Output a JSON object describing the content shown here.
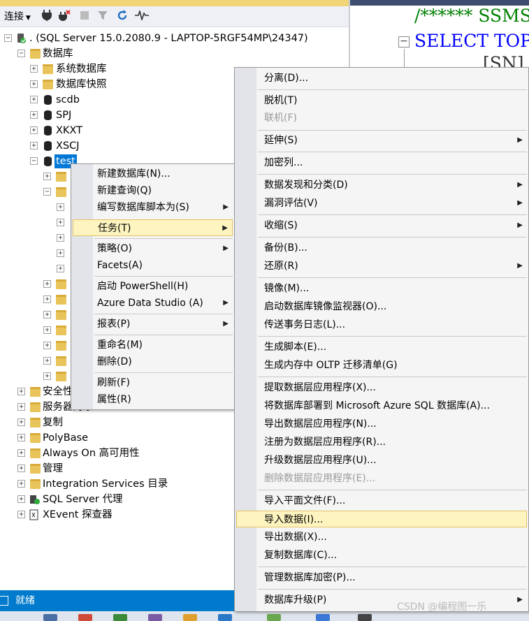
{
  "toolbar": {
    "connect_label": "连接"
  },
  "tree": {
    "server": ". (SQL Server 15.0.2080.9 - LAPTOP-5RGF54MP\\24347)",
    "databases": "数据库",
    "system_databases": "系统数据库",
    "db_snapshots": "数据库快照",
    "db_scdb": "scdb",
    "db_spj": "SPJ",
    "db_xkxt": "XKXT",
    "db_xscj": "XSCJ",
    "db_test": "test",
    "security": "安全性",
    "server_objects": "服务器对象",
    "replication": "复制",
    "polybase": "PolyBase",
    "always_on": "Always On 高可用性",
    "management": "管理",
    "integration_services": "Integration Services 目录",
    "sql_agent": "SQL Server 代理",
    "xevent": "XEvent 探查器"
  },
  "editor": {
    "line1": "/****** SSMS",
    "line2": "SELECT TOP (",
    "line3": "[SN]"
  },
  "status": {
    "text": "就绪"
  },
  "menu1": {
    "items": [
      {
        "label": "新建数据库(N)..."
      },
      {
        "label": "新建查询(Q)"
      },
      {
        "label": "编写数据库脚本为(S)"
      },
      {
        "label": "任务(T)"
      },
      {
        "label": "策略(O)"
      },
      {
        "label": "Facets(A)"
      },
      {
        "label": "启动 PowerShell(H)"
      },
      {
        "label": "Azure Data Studio (A)"
      },
      {
        "label": "报表(P)"
      },
      {
        "label": "重命名(M)"
      },
      {
        "label": "删除(D)"
      },
      {
        "label": "刷新(F)"
      },
      {
        "label": "属性(R)"
      }
    ]
  },
  "menu2": {
    "items": [
      {
        "label": "分离(D)..."
      },
      {
        "label": "脱机(T)"
      },
      {
        "label": "联机(F)"
      },
      {
        "label": "延伸(S)"
      },
      {
        "label": "加密列..."
      },
      {
        "label": "数据发现和分类(D)"
      },
      {
        "label": "漏洞评估(V)"
      },
      {
        "label": "收缩(S)"
      },
      {
        "label": "备份(B)..."
      },
      {
        "label": "还原(R)"
      },
      {
        "label": "镜像(M)..."
      },
      {
        "label": "启动数据库镜像监视器(O)..."
      },
      {
        "label": "传送事务日志(L)..."
      },
      {
        "label": "生成脚本(E)..."
      },
      {
        "label": "生成内存中 OLTP 迁移清单(G)"
      },
      {
        "label": "提取数据层应用程序(X)..."
      },
      {
        "label": "将数据库部署到 Microsoft Azure SQL 数据库(A)..."
      },
      {
        "label": "导出数据层应用程序(N)..."
      },
      {
        "label": "注册为数据层应用程序(R)..."
      },
      {
        "label": "升级数据层应用程序(U)..."
      },
      {
        "label": "删除数据层应用程序(E)..."
      },
      {
        "label": "导入平面文件(F)..."
      },
      {
        "label": "导入数据(I)..."
      },
      {
        "label": "导出数据(X)..."
      },
      {
        "label": "复制数据库(C)..."
      },
      {
        "label": "管理数据库加密(P)..."
      },
      {
        "label": "数据库升级(P)"
      }
    ]
  },
  "watermark": "CSDN @编程图一乐"
}
